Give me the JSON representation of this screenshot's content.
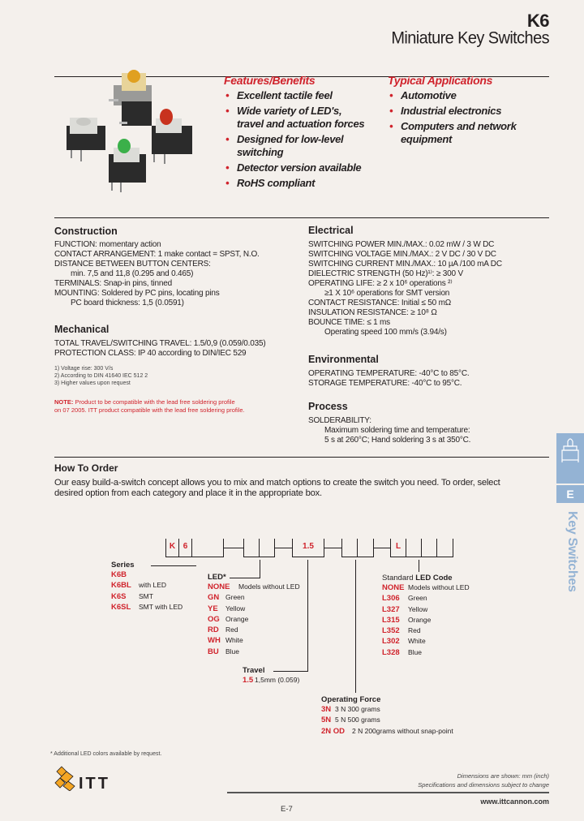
{
  "header": {
    "model": "K6",
    "title": "Miniature Key Switches"
  },
  "product_image": {
    "description": "Four K6 key switches: yellow LED SMT, white, green LED, red LED",
    "led_colors": [
      "#e0a020",
      "#d8d8d4",
      "#3bb04a",
      "#c8321e"
    ]
  },
  "features": {
    "heading": "Features/Benefits",
    "items": [
      "Excellent tactile feel",
      "Wide variety of LED's, travel and actuation forces",
      "Designed for low-level switching",
      "Detector version available",
      "RoHS compliant"
    ]
  },
  "applications": {
    "heading": "Typical Applications",
    "items": [
      "Automotive",
      "Industrial electronics",
      "Computers and network equipment"
    ]
  },
  "construction": {
    "heading": "Construction",
    "lines": [
      {
        "text": "FUNCTION: momentary action",
        "indent": false
      },
      {
        "text": "CONTACT ARRANGEMENT: 1 make contact = SPST, N.O.",
        "indent": false
      },
      {
        "text": "DISTANCE BETWEEN BUTTON CENTERS:",
        "indent": false
      },
      {
        "text": "min. 7,5 and 11,8 (0.295 and 0.465)",
        "indent": true
      },
      {
        "text": "TERMINALS: Snap-in pins, tinned",
        "indent": false
      },
      {
        "text": "MOUNTING: Soldered by PC pins, locating pins",
        "indent": false
      },
      {
        "text": "PC board thickness: 1,5 (0.0591)",
        "indent": true
      }
    ]
  },
  "mechanical": {
    "heading": "Mechanical",
    "lines": [
      {
        "text": "TOTAL TRAVEL/SWITCHING TRAVEL: 1.5/0,9 (0.059/0.035)",
        "indent": false
      },
      {
        "text": "PROTECTION CLASS: IP 40 according to DIN/IEC 529",
        "indent": false
      }
    ]
  },
  "footnotes": [
    "1) Voltage rise: 300 V/s",
    "2) According to DIN 41640 IEC 512 2",
    "3) Higher values upon request"
  ],
  "note": {
    "label": "NOTE:",
    "line1": "Product to be compatible with the lead free soldering profile",
    "line2": "on 07 2005. ITT product compatible with the lead free soldering profile."
  },
  "electrical": {
    "heading": "Electrical",
    "lines": [
      {
        "text": "SWITCHING POWER MIN./MAX.: 0.02 mW / 3 W DC",
        "indent": false
      },
      {
        "text": "SWITCHING VOLTAGE MIN./MAX.: 2 V DC / 30 V DC",
        "indent": false
      },
      {
        "text": "SWITCHING CURRENT MIN./MAX.: 10 µA /100 mA DC",
        "indent": false
      },
      {
        "text": "DIELECTRIC STRENGTH (50 Hz)¹⁾: ≥ 300 V",
        "indent": false
      },
      {
        "text": "OPERATING LIFE: ≥ 2 x 10⁶ operations ²⁾",
        "indent": false
      },
      {
        "text": "≥1 X 10⁶ operations for SMT version",
        "indent": true
      },
      {
        "text": "CONTACT RESISTANCE: Initial ≤ 50 mΩ",
        "indent": false
      },
      {
        "text": "INSULATION RESISTANCE: ≥ 10⁸ Ω",
        "indent": false
      },
      {
        "text": "BOUNCE TIME: ≤ 1 ms",
        "indent": false
      },
      {
        "text": "Operating speed 100 mm/s (3.94/s)",
        "indent": true
      }
    ]
  },
  "environmental": {
    "heading": "Environmental",
    "lines": [
      {
        "text": "OPERATING TEMPERATURE: -40°C to 85°C.",
        "indent": false
      },
      {
        "text": "STORAGE TEMPERATURE: -40°C to 95°C.",
        "indent": false
      }
    ]
  },
  "process": {
    "heading": "Process",
    "lines": [
      {
        "text": "SOLDERABILITY:",
        "indent": false
      },
      {
        "text": "Maximum soldering time and temperature:",
        "indent": true
      },
      {
        "text": "5 s at 260°C; Hand soldering 3 s at 350°C.",
        "indent": true
      }
    ]
  },
  "how_to_order": {
    "heading": "How To Order",
    "intro": "Our easy build-a-switch concept allows you to mix and match options to create the switch you need. To order, select desired option from each category and place it in the appropriate box.",
    "code_boxes": {
      "group1": [
        "K",
        "6",
        "",
        ""
      ],
      "group2": [
        "",
        ""
      ],
      "group3": [
        "1.5",
        ""
      ],
      "group4": [
        "",
        ""
      ],
      "group5": [
        "L",
        "",
        "",
        ""
      ]
    }
  },
  "series": {
    "heading": "Series",
    "options": [
      {
        "code": "K6B",
        "desc": ""
      },
      {
        "code": "K6BL",
        "desc": "with LED"
      },
      {
        "code": "K6S",
        "desc": "SMT"
      },
      {
        "code": "K6SL",
        "desc": "SMT with LED"
      }
    ]
  },
  "led": {
    "heading": "LED*",
    "options": [
      {
        "code": "NONE",
        "desc": "Models without LED"
      },
      {
        "code": "GN",
        "desc": "Green"
      },
      {
        "code": "YE",
        "desc": "Yellow"
      },
      {
        "code": "OG",
        "desc": "Orange"
      },
      {
        "code": "RD",
        "desc": "Red"
      },
      {
        "code": "WH",
        "desc": "White"
      },
      {
        "code": "BU",
        "desc": "Blue"
      }
    ]
  },
  "travel": {
    "heading": "Travel",
    "options": [
      {
        "code": "1.5",
        "desc": "1,5mm (0.059)"
      }
    ]
  },
  "operating_force": {
    "heading": "Operating Force",
    "options": [
      {
        "code": "3N",
        "desc": "3 N 300 grams"
      },
      {
        "code": "5N",
        "desc": "5 N 500 grams"
      },
      {
        "code": "2N OD",
        "desc": "2 N 200grams without snap-point"
      }
    ]
  },
  "standard_led_code": {
    "heading_plain": "Standard ",
    "heading_bold": "LED Code",
    "options": [
      {
        "code": "NONE",
        "desc": "Models without LED"
      },
      {
        "code": "L306",
        "desc": "Green"
      },
      {
        "code": "L327",
        "desc": "Yellow"
      },
      {
        "code": "L315",
        "desc": "Orange"
      },
      {
        "code": "L352",
        "desc": "Red"
      },
      {
        "code": "L302",
        "desc": "White"
      },
      {
        "code": "L328",
        "desc": "Blue"
      }
    ]
  },
  "led_footnote": "* Additional LED colors available by request.",
  "side_tab": {
    "letter": "E",
    "label": "Key Switches",
    "color": "#94b3d4"
  },
  "footer": {
    "logo_text": "ITT",
    "disclaimer1": "Dimensions are shown: mm (inch)",
    "disclaimer2": "Specifications and dimensions subject to change",
    "website": "www.ittcannon.com",
    "page_number": "E-7"
  },
  "colors": {
    "accent_red": "#d0232c",
    "background": "#f4f0ec",
    "text": "#231f20",
    "tab_blue": "#94b3d4",
    "logo_orange": "#f5a623"
  }
}
